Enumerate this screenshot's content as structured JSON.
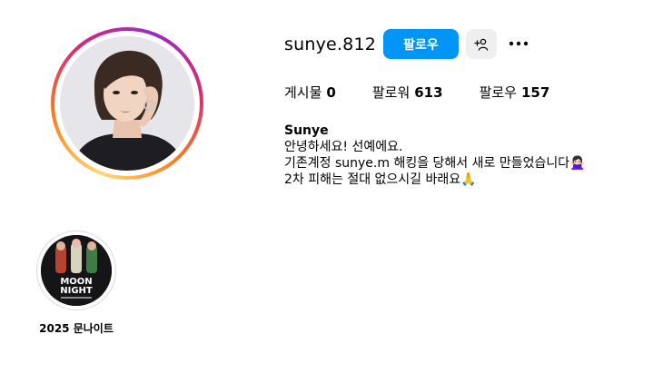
{
  "profile": {
    "username": "sunye.812",
    "follow_label": "팔로우",
    "suggest_icon": "add-person-icon",
    "more_icon": "more-horizontal-icon"
  },
  "stats": {
    "posts_label": "게시물",
    "posts_count": "0",
    "followers_label": "팔로워",
    "followers_count": "613",
    "following_label": "팔로우",
    "following_count": "157"
  },
  "bio": {
    "name": "Sunye",
    "line1": "안녕하세요! 선예에요.",
    "line2": "기존계정 sunye.m 해킹을 당해서 새로 만들었습니다🙅🏻‍♀️",
    "line3": "2차 피해는 절대 없으시길 바래요🙏"
  },
  "highlights": [
    {
      "label": "2025 문나이트",
      "cover_text_line1": "MOON",
      "cover_text_line2": "NIGHT"
    }
  ],
  "colors": {
    "primary_button": "#0095f6",
    "secondary_button": "#efefef",
    "ring_gradient": [
      "#feda75",
      "#fa7e1e",
      "#d62976",
      "#962fbf"
    ]
  }
}
